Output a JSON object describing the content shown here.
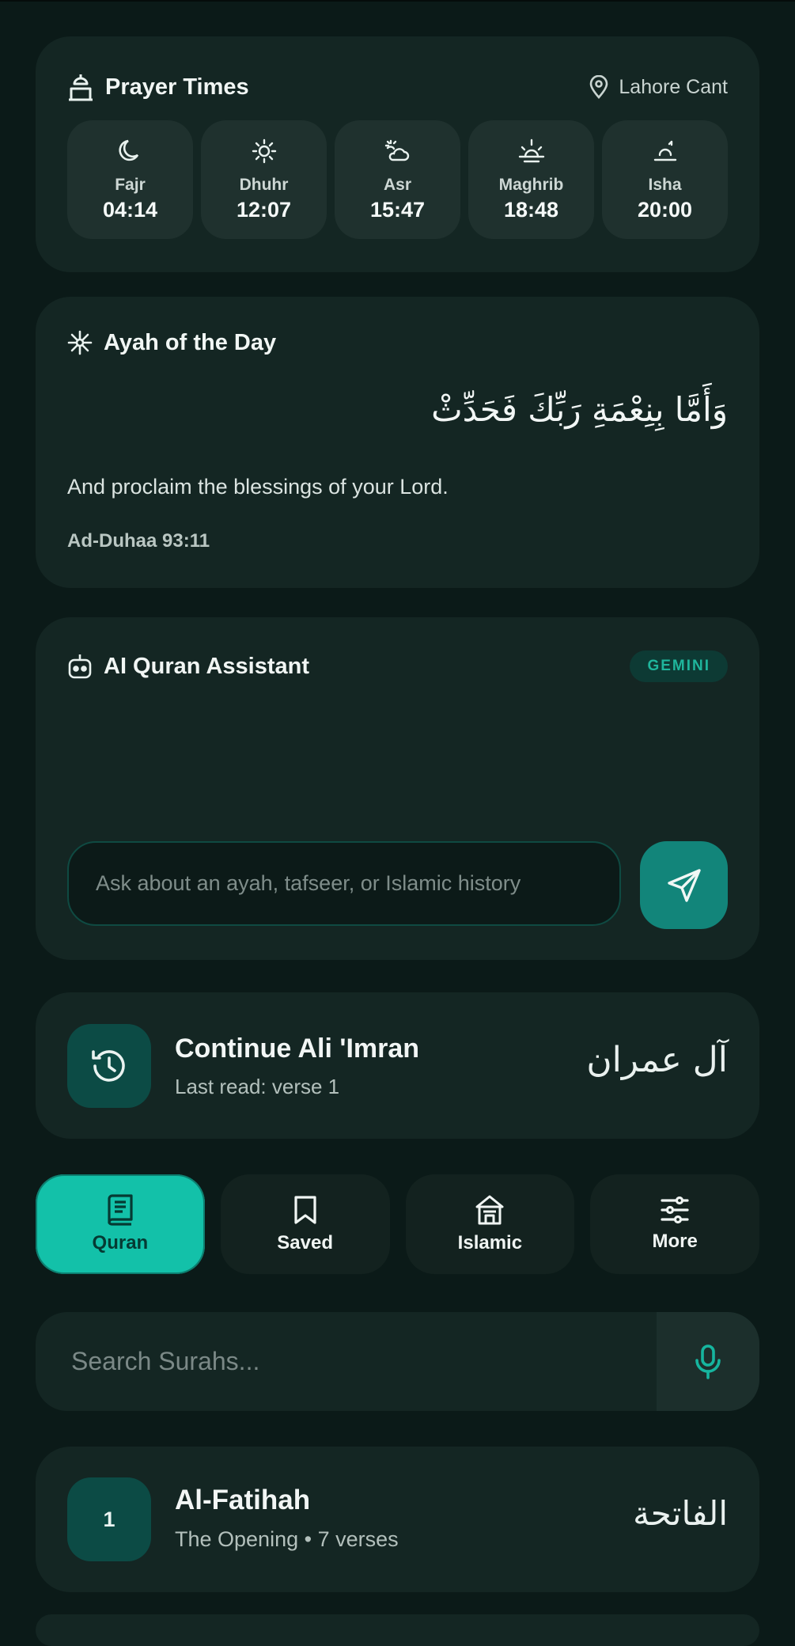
{
  "prayer": {
    "title": "Prayer Times",
    "location": "Lahore Cant",
    "times": [
      {
        "name": "Fajr",
        "time": "04:14",
        "icon": "moon-icon"
      },
      {
        "name": "Dhuhr",
        "time": "12:07",
        "icon": "sun-icon"
      },
      {
        "name": "Asr",
        "time": "15:47",
        "icon": "sun-cloud-icon"
      },
      {
        "name": "Maghrib",
        "time": "18:48",
        "icon": "sunset-icon"
      },
      {
        "name": "Isha",
        "time": "20:00",
        "icon": "moon-rise-icon"
      }
    ]
  },
  "ayah": {
    "title": "Ayah of the Day",
    "arabic": "وَأَمَّا بِنِعْمَةِ رَبِّكَ فَحَدِّثْ",
    "translation": "And proclaim the blessings of your Lord.",
    "reference": "Ad-Duhaa 93:11"
  },
  "assistant": {
    "title": "AI Quran Assistant",
    "badge": "GEMINI",
    "input_placeholder": "Ask about an ayah, tafseer, or Islamic history"
  },
  "continue": {
    "title": "Continue Ali 'Imran",
    "subtitle": "Last read: verse 1",
    "arabic": "آل عمران"
  },
  "tabs": [
    {
      "label": "Quran",
      "icon": "book-icon",
      "active": true
    },
    {
      "label": "Saved",
      "icon": "bookmark-icon",
      "active": false
    },
    {
      "label": "Islamic",
      "icon": "mosque-icon",
      "active": false
    },
    {
      "label": "More",
      "icon": "sliders-icon",
      "active": false
    }
  ],
  "search": {
    "placeholder": "Search Surahs..."
  },
  "surahs": [
    {
      "number": "1",
      "name": "Al-Fatihah",
      "meta": "The Opening • 7 verses",
      "arabic": "الفاتحة"
    }
  ],
  "colors": {
    "background": "#0b1a18",
    "card": "#142623",
    "accent": "#13c1a9",
    "accent_dark": "#12857a"
  }
}
